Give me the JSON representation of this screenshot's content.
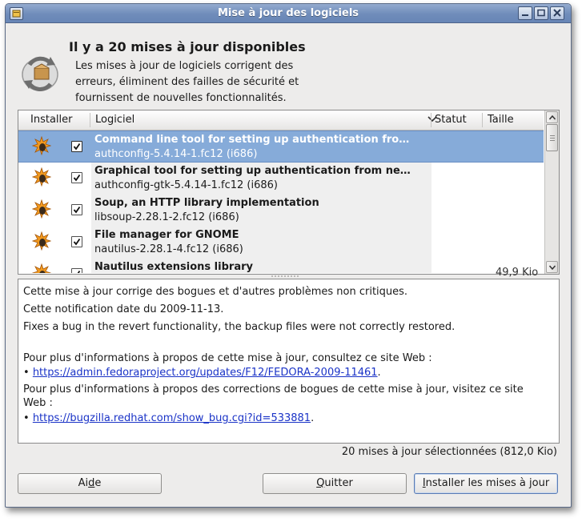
{
  "window": {
    "title": "Mise à jour des logiciels"
  },
  "header": {
    "headline": "Il y a 20 mises à jour disponibles",
    "description_lines": [
      "Les mises à jour de logiciels corrigent des",
      "erreurs, éliminent des failles de sécurité et",
      "fournissent de nouvelles fonctionnalités."
    ]
  },
  "table": {
    "columns": [
      "Installer",
      "Logiciel",
      "Statut",
      "Taille"
    ],
    "rows": [
      {
        "name": "Command line tool for setting up authentication fro…",
        "version": "authconfig-5.4.14-1.fc12 (i686)",
        "checked": true,
        "selected": true
      },
      {
        "name": "Graphical tool for setting up authentication from ne…",
        "version": "authconfig-gtk-5.4.14-1.fc12 (i686)",
        "checked": true,
        "selected": false
      },
      {
        "name": "Soup, an HTTP library implementation",
        "version": "libsoup-2.28.1-2.fc12 (i686)",
        "checked": true,
        "selected": false
      },
      {
        "name": "File manager for GNOME",
        "version": "nautilus-2.28.1-4.fc12 (i686)",
        "checked": true,
        "selected": false
      },
      {
        "name": "Nautilus extensions library",
        "version": "",
        "checked": true,
        "selected": false
      }
    ],
    "partial_size": "49,9 Kio"
  },
  "details": {
    "line1": "Cette mise à jour corrige des bogues et d'autres problèmes non critiques.",
    "line2": "Cette notification date du 2009-11-13.",
    "line3": "Fixes a bug in the revert functionality, the backup files were not correctly restored.",
    "info1": "Pour plus d'informations à propos de cette mise à jour, consultez ce site Web :",
    "link1": "https://admin.fedoraproject.org/updates/F12/FEDORA-2009-11461",
    "info2a": "Pour plus d'informations à propos des corrections de bogues de cette mise à jour, visitez ce site",
    "info2b": "Web :",
    "link2": "https://bugzilla.redhat.com/show_bug.cgi?id=533881",
    "bullet": "•",
    "period": "."
  },
  "summary": "20 mises à jour sélectionnées (812,0 Kio)",
  "buttons": {
    "help_prefix": "Ai",
    "help_mnemonic": "d",
    "help_suffix": "e",
    "quit_mnemonic": "Q",
    "quit_suffix": "uitter",
    "install_mnemonic": "I",
    "install_suffix": "nstaller les mises à jour"
  },
  "colors": {
    "titlebar": "#6f8cba",
    "selection": "#86abd9",
    "link": "#1a33c7"
  },
  "icons": [
    "application-menu-icon",
    "minimize-icon",
    "maximize-icon",
    "close-icon",
    "software-update-icon",
    "package-update-icon",
    "checkbox-checked-icon",
    "sort-down-icon",
    "scroll-up-icon",
    "scroll-down-icon"
  ]
}
